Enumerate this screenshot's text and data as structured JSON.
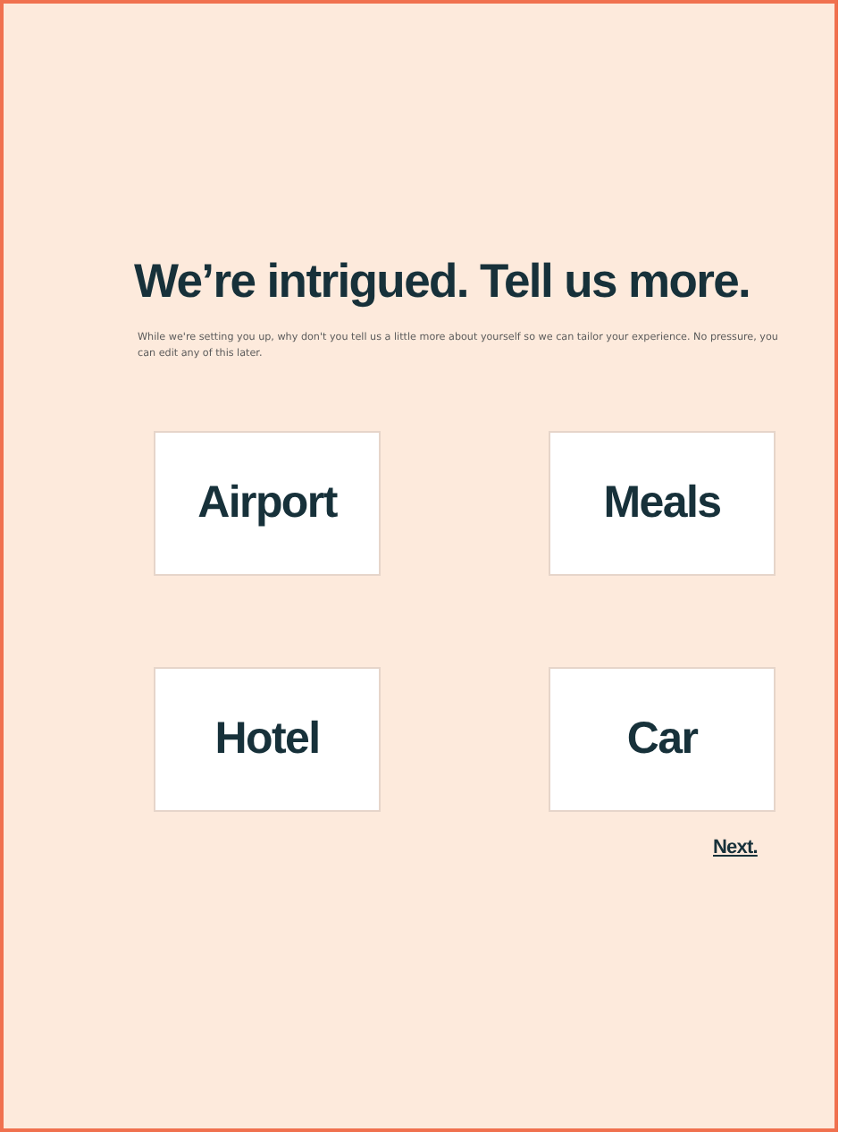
{
  "title": "We’re intrigued. Tell us more.",
  "description": "While we're setting you up, why don't you tell us a little more about yourself so we can tailor your experience. No pressure, you can edit any of this later.",
  "options": [
    {
      "label": "Airport"
    },
    {
      "label": "Meals"
    },
    {
      "label": "Hotel"
    },
    {
      "label": "Car"
    }
  ],
  "next": "Next."
}
